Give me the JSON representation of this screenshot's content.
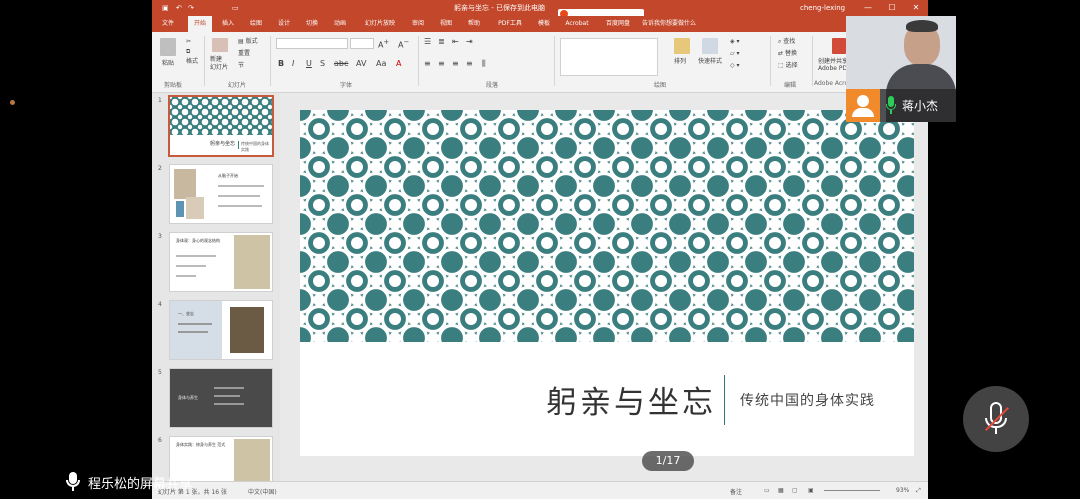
{
  "titlebar": {
    "doc_title": "躬亲与坐忘 - 已保存到此电脑",
    "user": "cheng-lexing"
  },
  "menu_tabs": [
    "文件",
    "开始",
    "插入",
    "绘图",
    "设计",
    "切换",
    "动画",
    "幻灯片放映",
    "审阅",
    "视图",
    "帮助",
    "PDF工具",
    "模板",
    "Acrobat",
    "百度网盘",
    "告诉我你想要做什么"
  ],
  "ribbon": {
    "paste": "粘贴",
    "format_painter": "格式",
    "new_slide": "新建\n幻灯片",
    "reset": "重置",
    "section": "节",
    "arrange": "排列",
    "quick_styles": "快速样式",
    "find": "查找",
    "replace": "替换",
    "select": "选择",
    "create_pdf": "创建并共享\nAdobe PDF",
    "groups": [
      "剪贴板",
      "幻灯片",
      "字体",
      "段落",
      "绘图",
      "编辑",
      "Adobe Acrobat"
    ]
  },
  "thumbnails": [
    {
      "num": "1",
      "title": "躬亲与坐忘",
      "subtitle": "传统中国的身体实践"
    },
    {
      "num": "2",
      "title": "从脑子开始"
    },
    {
      "num": "3",
      "title": "身体观：身心的观念结构"
    },
    {
      "num": "4",
      "title": "一、坐忘"
    },
    {
      "num": "5",
      "title": "身体与养生"
    },
    {
      "num": "6",
      "title": "身体实践：修身与养生 范式"
    }
  ],
  "slide": {
    "title": "躬亲与坐忘",
    "subtitle": "传统中国的身体实践",
    "pattern_color": "#3a7e7f",
    "page_indicator": "1/17"
  },
  "statusbar": {
    "slide_count": "幻灯片 第 1 张，共 16 张",
    "language": "中文(中国)",
    "notes": "备注",
    "zoom": "93%"
  },
  "meeting": {
    "participant_name": "蒋小杰",
    "share_label": "程乐松的屏幕共享"
  }
}
